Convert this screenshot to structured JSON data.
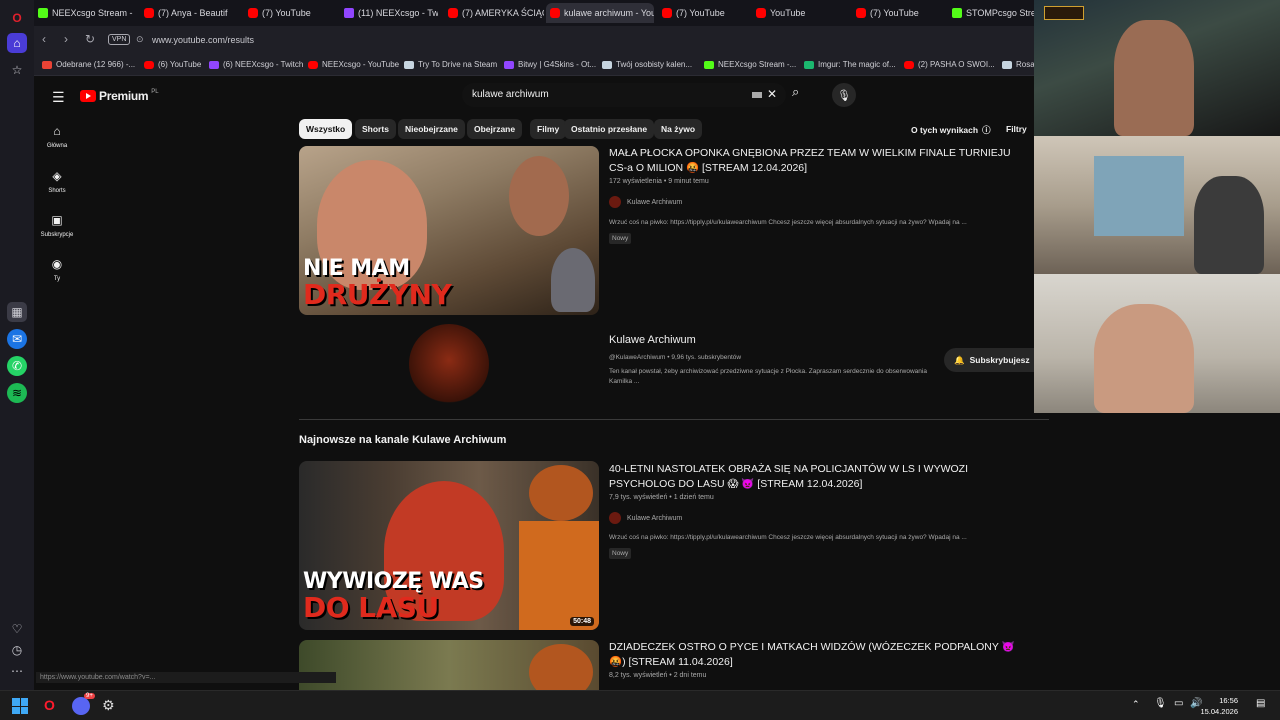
{
  "tabs": [
    {
      "label": "NEEXcsgo Stream - W",
      "favicon": "kick"
    },
    {
      "label": "(7) Anya - Beautif",
      "favicon": "yt"
    },
    {
      "label": "(7) YouTube",
      "favicon": "yt"
    },
    {
      "label": "(11) NEEXcsgo - Twitc",
      "favicon": "tw"
    },
    {
      "label": "(7) AMERYKA ŚCIĄGA",
      "favicon": "yt"
    },
    {
      "label": "kulawe archiwum - YouTu",
      "favicon": "yt"
    },
    {
      "label": "(7) YouTube",
      "favicon": "yt"
    },
    {
      "label": "YouTube",
      "favicon": "yt"
    },
    {
      "label": "(7) YouTube",
      "favicon": "yt"
    },
    {
      "label": "STOMPcsgo Stream",
      "favicon": "kick"
    }
  ],
  "address": {
    "vpn": "VPN",
    "url": "www.youtube.com/results"
  },
  "bookmarks": [
    "Odebrane (12 966) -...",
    "(6) YouTube",
    "(6) NEEXcsgo - Twitch",
    "NEEXcsgo - YouTube",
    "Try To Drive na Steam",
    "Bitwy | G4Skins - Ot...",
    "Twój osobisty kalen...",
    "NEEXcsgo Stream -...",
    "Imgur: The magic of...",
    "(2) PASHA O SWOI...",
    "Rosa..."
  ],
  "yt": {
    "logo": "Premium",
    "logo_region": "PL",
    "search_value": "kulawe archiwum",
    "guide": [
      {
        "label": "Główna",
        "icon": "home-icon"
      },
      {
        "label": "Shorts",
        "icon": "shorts-icon"
      },
      {
        "label": "Subskrypcje",
        "icon": "subscriptions-icon"
      },
      {
        "label": "Ty",
        "icon": "you-icon"
      }
    ],
    "chips": [
      "Wszystko",
      "Shorts",
      "Nieobejrzane",
      "Obejrzane",
      "Filmy",
      "Ostatnio przesłane",
      "Na żywo"
    ],
    "about_results": "O tych wynikach",
    "filters": "Filtry",
    "video1": {
      "title": "MAŁA PŁOCKA OPONKA GNĘBIONA PRZEZ TEAM W WIELKIM FINALE TURNIEJU CS-a O MILION 🤬 [STREAM 12.04.2026]",
      "meta": "172 wyświetlenia • 9 minut temu",
      "channel": "Kulawe Archiwum",
      "desc": "Wrzuć coś na piwko: https://tipply.pl/u/kulawearchiwum Chcesz jeszcze więcej absurdalnych sytuacji na żywo? Wpadaj na ...",
      "badge": "Nowy",
      "thumb_line1": "NIE MAM",
      "thumb_line2": "DRUŻYNY"
    },
    "channel_card": {
      "name": "Kulawe Archiwum",
      "meta": "@KulaweArchiwum • 9,96 tys. subskrybentów",
      "desc": "Ten kanał powstał, żeby archiwizować przedziwne sytuacje z Płocka. Zapraszam serdecznie do obserwowania Kamilka ...",
      "subscribe": "Subskrybujesz"
    },
    "section_title": "Najnowsze na kanale Kulawe Archiwum",
    "video2": {
      "title": "40-LETNI NASTOLATEK OBRAŻA SIĘ NA POLICJANTÓW W LS I WYWOZI PSYCHOLOG DO LASU 😱 👿 [STREAM 12.04.2026]",
      "meta": "7,9 tys. wyświetleń • 1 dzień temu",
      "channel": "Kulawe Archiwum",
      "desc": "Wrzuć coś na piwko: https://tipply.pl/u/kulawearchiwum Chcesz jeszcze więcej absurdalnych sytuacji na żywo? Wpadaj na ...",
      "badge": "Nowy",
      "duration": "50:48",
      "thumb_line1": "WYWIOZĘ WAS",
      "thumb_line2": "DO LASU"
    },
    "video3": {
      "title": "DZIADECZEK OSTRO O PYCE I MATKACH WIDZÓW (WÓZECZEK PODPALONY 👿 🤬) [STREAM 11.04.2026]",
      "meta": "8,2 tys. wyświetleń • 2 dni temu"
    }
  },
  "status_url": "https://www.youtube.com/watch?v=...",
  "taskbar": {
    "time": "16:56",
    "date": "15.04.2026",
    "discord_badge": "9+"
  },
  "colors": {
    "accent": "#ff0000",
    "chip_selected": "#f1f1f1",
    "background": "#0f0f0f"
  }
}
